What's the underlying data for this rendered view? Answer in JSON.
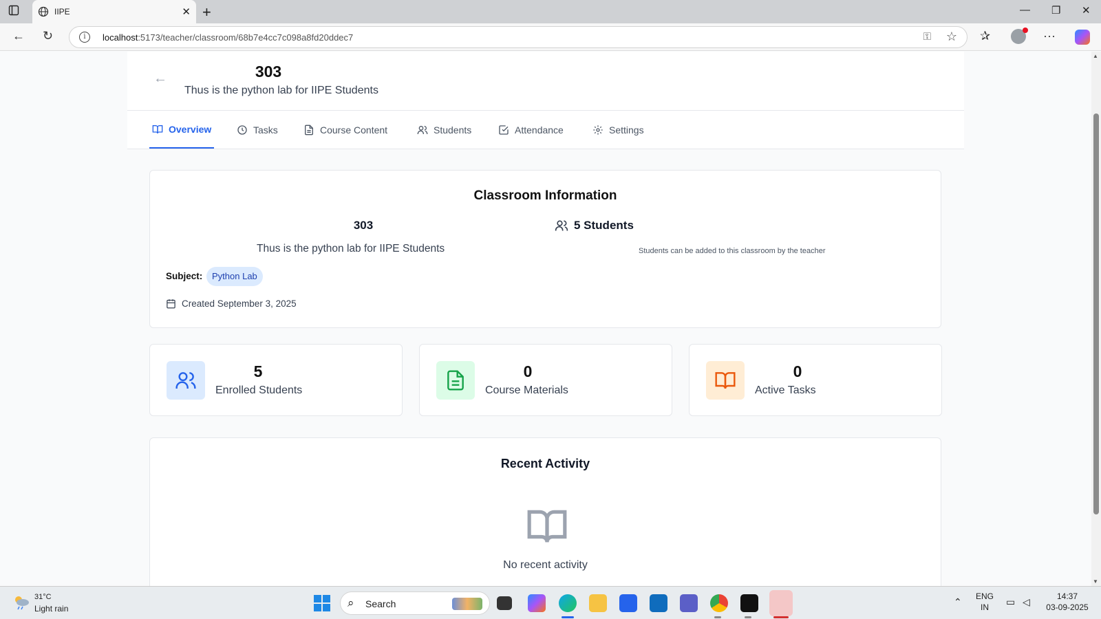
{
  "browser": {
    "tab_title": "IIPE",
    "url_host": "localhost",
    "url_path": ":5173/teacher/classroom/68b7e4cc7c098a8fd20ddec7"
  },
  "header": {
    "classroom_name": "303",
    "classroom_description": "Thus is the python lab for IIPE Students"
  },
  "tabs": [
    {
      "label": "Overview",
      "icon": "book-open-icon",
      "active": true
    },
    {
      "label": "Tasks",
      "icon": "clock-icon",
      "active": false
    },
    {
      "label": "Course Content",
      "icon": "file-text-icon",
      "active": false
    },
    {
      "label": "Students",
      "icon": "users-icon",
      "active": false
    },
    {
      "label": "Attendance",
      "icon": "check-square-icon",
      "active": false
    },
    {
      "label": "Settings",
      "icon": "gear-icon",
      "active": false
    }
  ],
  "info": {
    "title": "Classroom Information",
    "name": "303",
    "description": "Thus is the python lab for IIPE Students",
    "student_count": "5 Students",
    "note": "Students can be added to this classroom by the teacher",
    "subject_label": "Subject:",
    "subject": "Python Lab",
    "created": "Created September 3, 2025"
  },
  "stats": [
    {
      "value": "5",
      "label": "Enrolled Students",
      "icon": "users-icon",
      "color": "#2563eb",
      "bg": "#dbeafe"
    },
    {
      "value": "0",
      "label": "Course Materials",
      "icon": "file-text-icon",
      "color": "#16a34a",
      "bg": "#dcfce7"
    },
    {
      "value": "0",
      "label": "Active Tasks",
      "icon": "book-open-icon",
      "color": "#ea580c",
      "bg": "#ffedd5"
    }
  ],
  "activity": {
    "title": "Recent Activity",
    "empty": "No recent activity"
  },
  "taskbar": {
    "temperature": "31°C",
    "weather": "Light rain",
    "search": "Search",
    "lang1": "ENG",
    "lang2": "IN",
    "time": "14:37",
    "date": "03-09-2025"
  },
  "colors": {
    "accent": "#2563eb"
  }
}
